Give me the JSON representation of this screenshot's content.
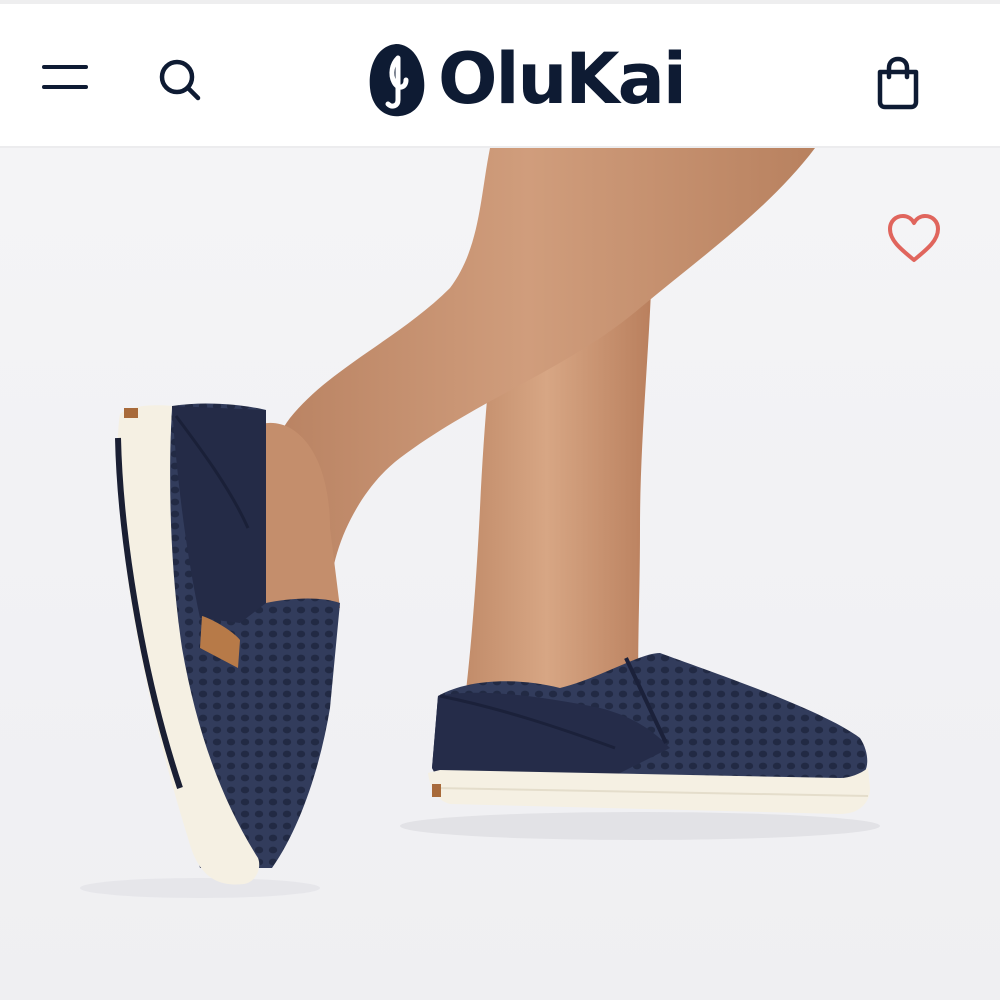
{
  "header": {
    "menu_icon": "hamburger-menu-icon",
    "search_icon": "search-icon",
    "brand_name": "OluKai",
    "logo_icon": "olukai-hook-logo-icon",
    "cart_icon": "shopping-bag-icon"
  },
  "product": {
    "image_description_icon": "product-photo-slip-on-sneakers",
    "favorite_icon": "heart-outline-icon"
  },
  "colors": {
    "brand_navy": "#0e1b33",
    "heart_red": "#e0655d",
    "hero_background": "#f3f3f5",
    "shoe_navy": "#2c3552",
    "sole_cream": "#f4efe2",
    "skin": "#c99573"
  }
}
